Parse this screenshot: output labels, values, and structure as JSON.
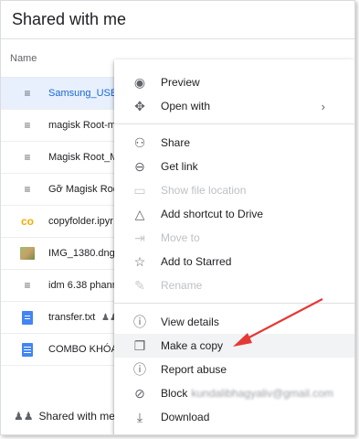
{
  "header": {
    "title": "Shared with me"
  },
  "columns": {
    "name": "Name"
  },
  "files": [
    {
      "name": "Samsung_USB",
      "icon": "zip-icon",
      "selected": true
    },
    {
      "name": "magisk Root-m",
      "icon": "zip-icon"
    },
    {
      "name": "Magisk Root_M",
      "icon": "zip-icon"
    },
    {
      "name": "Gỡ Magisk Roo",
      "icon": "zip-icon"
    },
    {
      "name": "copyfolder.ipyr",
      "icon": "colab-icon"
    },
    {
      "name": "IMG_1380.dng",
      "icon": "image-icon"
    },
    {
      "name": "idm 6.38 phanm",
      "icon": "zip-icon"
    },
    {
      "name": "transfer.txt",
      "icon": "text-file-icon",
      "shared": true
    },
    {
      "name": "COMBO KHÓA",
      "icon": "doc-icon"
    }
  ],
  "footer": {
    "label": "Shared with me"
  },
  "menu": {
    "items": [
      {
        "label": "Preview",
        "icon": "eye-icon",
        "glyph": "◉",
        "disabled": false
      },
      {
        "label": "Open with",
        "icon": "move-arrows-icon",
        "glyph": "✥",
        "disabled": false,
        "submenu": "›"
      },
      {
        "separator": true
      },
      {
        "label": "Share",
        "icon": "add-person-icon",
        "glyph": "⚇",
        "disabled": false
      },
      {
        "label": "Get link",
        "icon": "link-icon",
        "glyph": "⊖",
        "disabled": false
      },
      {
        "label": "Show file location",
        "icon": "folder-icon",
        "glyph": "▭",
        "disabled": true
      },
      {
        "label": "Add shortcut to Drive",
        "icon": "drive-shortcut-icon",
        "glyph": "△",
        "disabled": false
      },
      {
        "label": "Move to",
        "icon": "move-to-icon",
        "glyph": "⇥",
        "disabled": true
      },
      {
        "label": "Add to Starred",
        "icon": "star-icon",
        "glyph": "☆",
        "disabled": false
      },
      {
        "label": "Rename",
        "icon": "pencil-icon",
        "glyph": "✎",
        "disabled": true
      },
      {
        "separator": true
      },
      {
        "label": "View details",
        "icon": "info-icon",
        "glyph": "ⓘ",
        "disabled": false
      },
      {
        "label": "Make a copy",
        "icon": "copy-icon",
        "glyph": "❐",
        "disabled": false,
        "highlighted": true
      },
      {
        "label": "Report abuse",
        "icon": "report-icon",
        "glyph": "⓵",
        "disabled": false
      },
      {
        "label": "Block",
        "icon": "block-icon",
        "glyph": "⊘",
        "disabled": false,
        "suffix": "kundalibhagyaliv@gmail.com"
      },
      {
        "label": "Download",
        "icon": "download-icon",
        "glyph": "⤓",
        "disabled": false
      }
    ]
  },
  "colors": {
    "accent": "#1967d2",
    "arrow": "#e53935",
    "selected_bg": "#e8f0fe"
  }
}
